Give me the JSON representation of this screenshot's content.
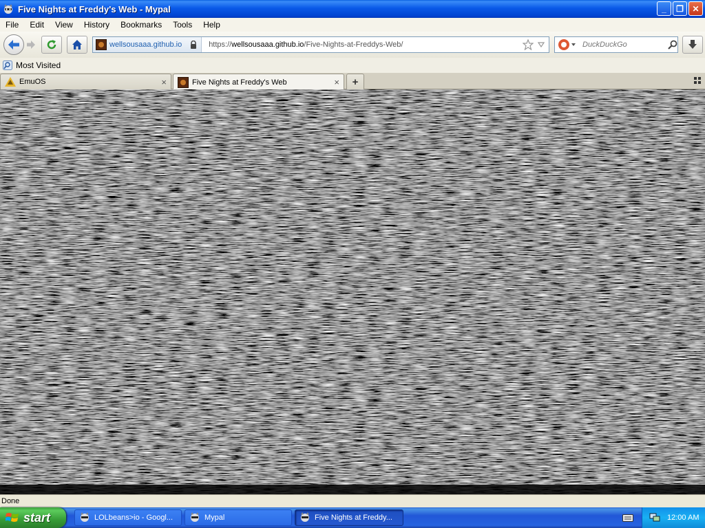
{
  "window": {
    "title": "Five Nights at Freddy's Web - Mypal",
    "minimize": "_",
    "maximize": "❐",
    "close": "✕"
  },
  "menu": [
    "File",
    "Edit",
    "View",
    "History",
    "Bookmarks",
    "Tools",
    "Help"
  ],
  "nav": {
    "site_domain": "wellsousaaa.github.io",
    "url_prefix": "https://",
    "url_host": "wellsousaaa.github.io",
    "url_path": "/Five-Nights-at-Freddys-Web/",
    "search_placeholder": "DuckDuckGo"
  },
  "bookmarks": {
    "most_visited": "Most Visited"
  },
  "tabs": [
    {
      "label": "EmuOS",
      "close": "×"
    },
    {
      "label": "Five Nights at Freddy's Web",
      "close": "×"
    }
  ],
  "new_tab": "+",
  "status": "Done",
  "taskbar": {
    "start": "start",
    "items": [
      {
        "label": "LOLbeans>io - Googl..."
      },
      {
        "label": "Mypal"
      },
      {
        "label": "Five Nights at Freddy..."
      }
    ],
    "clock": "12:00 AM"
  }
}
